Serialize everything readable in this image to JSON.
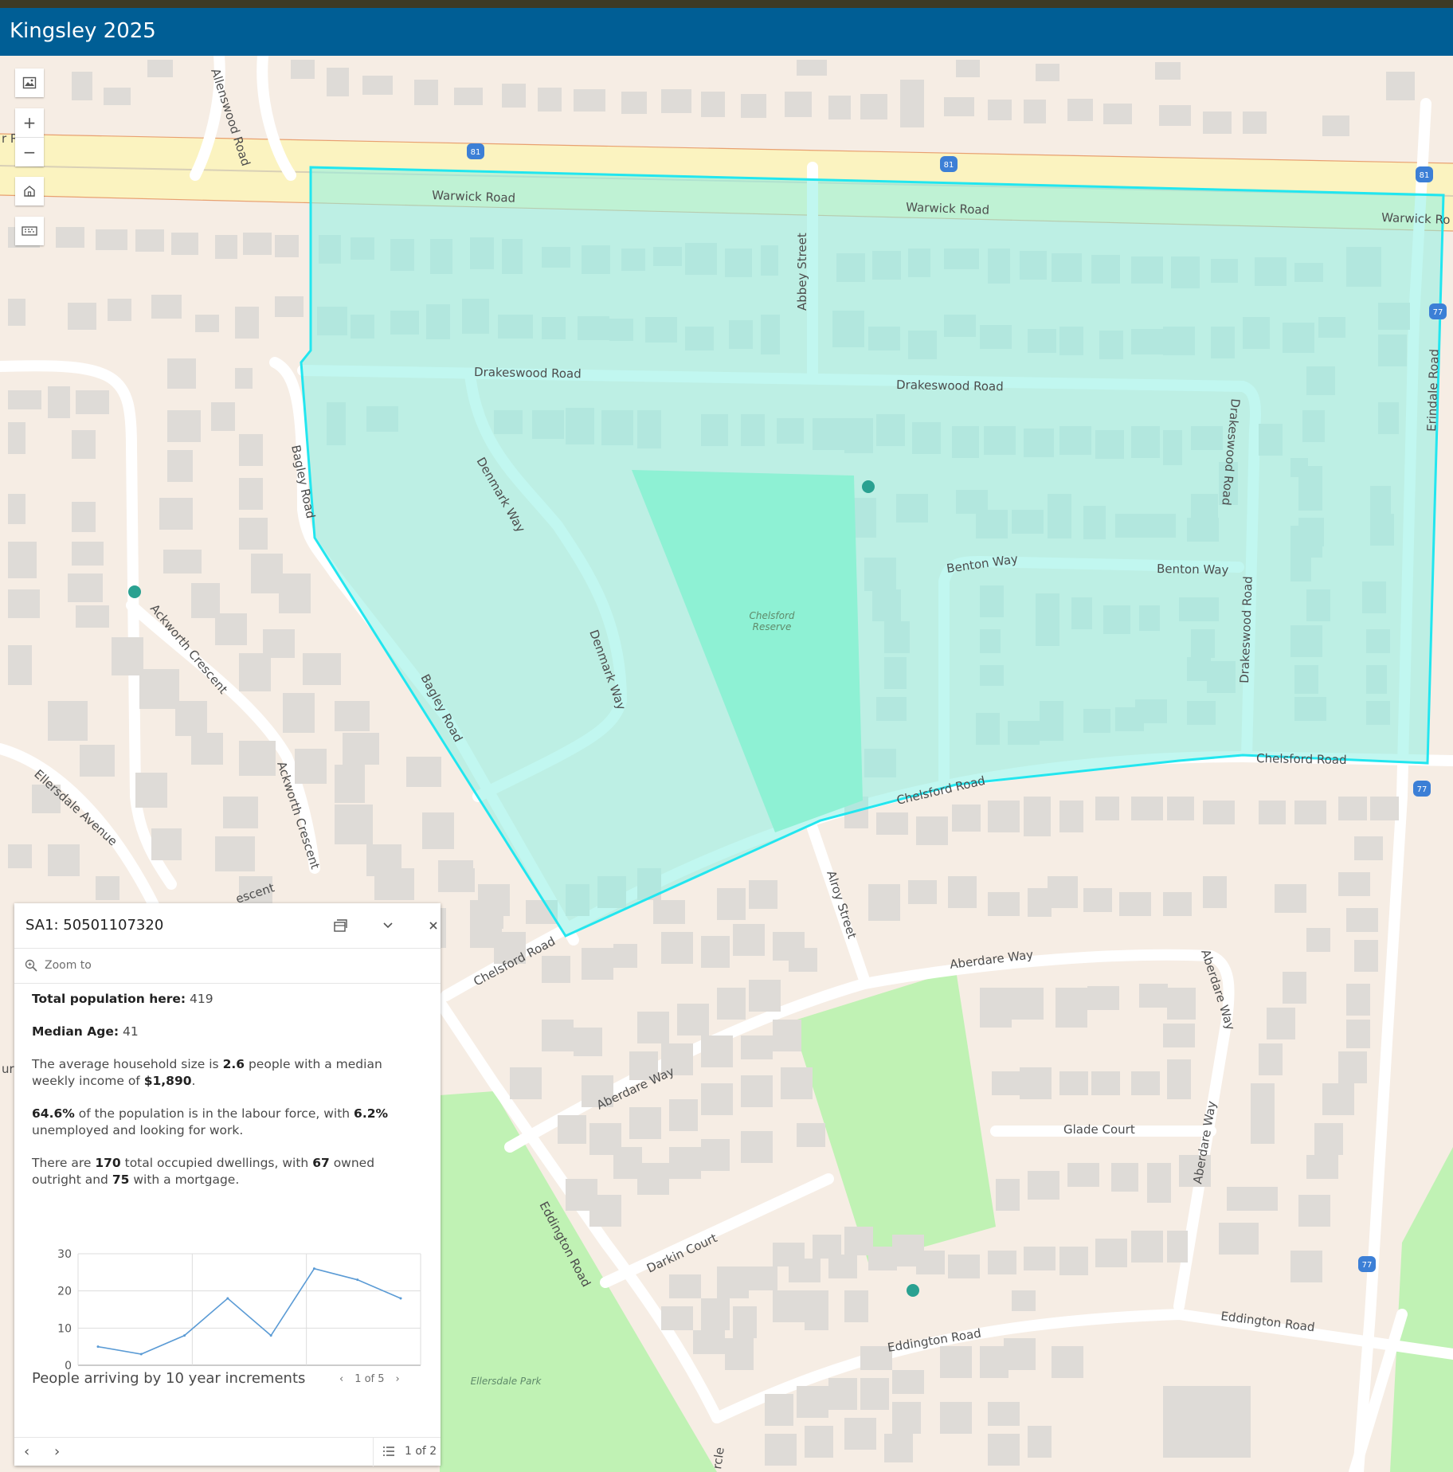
{
  "header": {
    "title": "Kingsley 2025"
  },
  "map": {
    "roads": {
      "allenswood": "Allenswood Road",
      "warwick_1": "Warwick Road",
      "warwick_2": "Warwick Road",
      "warwick_3": "Warwick Ro",
      "abbey": "Abbey Street",
      "drakeswood_1": "Drakeswood Road",
      "drakeswood_2": "Drakeswood Road",
      "drakeswood_3": "Drakeswood Road",
      "drakeswood_4": "Drakeswood Road",
      "erindale": "Erindale Road",
      "bagley_1": "Bagley Road",
      "bagley_2": "Bagley Road",
      "denmark_1": "Denmark Way",
      "denmark_2": "Denmark Way",
      "benton_1": "Benton Way",
      "benton_2": "Benton Way",
      "chelsford_1": "Chelsford Road",
      "chelsford_2": "Chelsford Road",
      "chelsford_3": "Chelsford Road",
      "ackworth_1": "Ackworth Crescent",
      "ackworth_2": "Ackworth Crescent",
      "ellersdale_ave": "Ellersdale Avenue",
      "crescent_frag": "escent",
      "alroy": "Alroy Street",
      "aberdare_1": "Aberdare Way",
      "aberdare_2": "Aberdare Way",
      "aberdare_3": "Aberdare Way",
      "aberdare_4": "Aberdare Way",
      "glade": "Glade Court",
      "darkin": "Darkin Court",
      "eddington_1": "Eddington Road",
      "eddington_2": "Eddington Road",
      "eddington_3": "Eddington Road",
      "frag_left_1": "r R",
      "frag_left_2": "url",
      "frag_bottom": "rcle"
    },
    "parks": {
      "chelsford_reserve_1": "Chelsford",
      "chelsford_reserve_2": "Reserve",
      "ellersdale_park": "Ellersdale Park"
    },
    "shields": {
      "route_a": "81",
      "route_b": "77"
    },
    "colors": {
      "selection_fill": "#b3f4ec",
      "selection_stroke": "#22e6ef",
      "park": "#c0f2b4",
      "reserve": "#8ff1c0",
      "building": "#dedbd7",
      "road_major": "#fbf3c0"
    }
  },
  "controls": {
    "basemap": "basemap-gallery-icon",
    "zoom_in": "+",
    "zoom_out": "−",
    "home": "home-icon",
    "keyboard": "keyboard-icon"
  },
  "popup": {
    "title": "SA1: 50501107320",
    "zoom_to": "Zoom to",
    "fields": {
      "total_population_label": "Total population here:",
      "total_population": "419",
      "median_age_label": "Median Age:",
      "median_age": "41",
      "hh_text_1": "The average household size is",
      "hh_size": "2.6",
      "hh_text_2": "people with a median weekly income of",
      "hh_income": "$1,890",
      "hh_text_3": ".",
      "labour_force": "64.6%",
      "lf_text_1": "of the population is in the labour force, with",
      "unemployed": "6.2%",
      "lf_text_2": "unemployed and looking for work.",
      "dw_text_1": "There are",
      "dwellings": "170",
      "dw_text_2": "total occupied dwellings, with",
      "owned": "67",
      "dw_text_3": "owned outright and",
      "mortgage": "75",
      "dw_text_4": "with a mortgage."
    },
    "chart_caption": "People arriving by 10 year increments",
    "chart_pager": "1 of 5",
    "feature_count": "1 of 2"
  },
  "chart_data": {
    "type": "line",
    "title": "People arriving by 10 year increments",
    "values": [
      5,
      3,
      8,
      18,
      8,
      26,
      23,
      18
    ],
    "ylim": [
      0,
      30
    ],
    "yticks": [
      0,
      10,
      20,
      30
    ],
    "grid": true,
    "color": "#5b9bd5"
  }
}
